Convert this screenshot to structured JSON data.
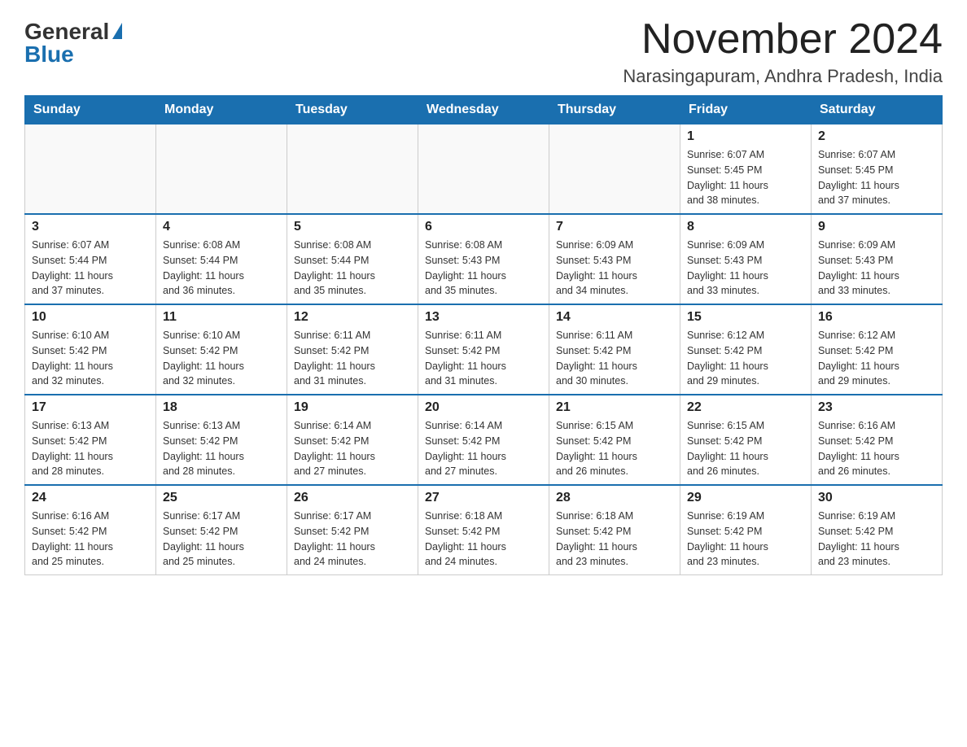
{
  "logo": {
    "general": "General",
    "blue": "Blue"
  },
  "title": {
    "month": "November 2024",
    "location": "Narasingapuram, Andhra Pradesh, India"
  },
  "weekdays": [
    "Sunday",
    "Monday",
    "Tuesday",
    "Wednesday",
    "Thursday",
    "Friday",
    "Saturday"
  ],
  "weeks": [
    [
      {
        "day": "",
        "info": ""
      },
      {
        "day": "",
        "info": ""
      },
      {
        "day": "",
        "info": ""
      },
      {
        "day": "",
        "info": ""
      },
      {
        "day": "",
        "info": ""
      },
      {
        "day": "1",
        "info": "Sunrise: 6:07 AM\nSunset: 5:45 PM\nDaylight: 11 hours\nand 38 minutes."
      },
      {
        "day": "2",
        "info": "Sunrise: 6:07 AM\nSunset: 5:45 PM\nDaylight: 11 hours\nand 37 minutes."
      }
    ],
    [
      {
        "day": "3",
        "info": "Sunrise: 6:07 AM\nSunset: 5:44 PM\nDaylight: 11 hours\nand 37 minutes."
      },
      {
        "day": "4",
        "info": "Sunrise: 6:08 AM\nSunset: 5:44 PM\nDaylight: 11 hours\nand 36 minutes."
      },
      {
        "day": "5",
        "info": "Sunrise: 6:08 AM\nSunset: 5:44 PM\nDaylight: 11 hours\nand 35 minutes."
      },
      {
        "day": "6",
        "info": "Sunrise: 6:08 AM\nSunset: 5:43 PM\nDaylight: 11 hours\nand 35 minutes."
      },
      {
        "day": "7",
        "info": "Sunrise: 6:09 AM\nSunset: 5:43 PM\nDaylight: 11 hours\nand 34 minutes."
      },
      {
        "day": "8",
        "info": "Sunrise: 6:09 AM\nSunset: 5:43 PM\nDaylight: 11 hours\nand 33 minutes."
      },
      {
        "day": "9",
        "info": "Sunrise: 6:09 AM\nSunset: 5:43 PM\nDaylight: 11 hours\nand 33 minutes."
      }
    ],
    [
      {
        "day": "10",
        "info": "Sunrise: 6:10 AM\nSunset: 5:42 PM\nDaylight: 11 hours\nand 32 minutes."
      },
      {
        "day": "11",
        "info": "Sunrise: 6:10 AM\nSunset: 5:42 PM\nDaylight: 11 hours\nand 32 minutes."
      },
      {
        "day": "12",
        "info": "Sunrise: 6:11 AM\nSunset: 5:42 PM\nDaylight: 11 hours\nand 31 minutes."
      },
      {
        "day": "13",
        "info": "Sunrise: 6:11 AM\nSunset: 5:42 PM\nDaylight: 11 hours\nand 31 minutes."
      },
      {
        "day": "14",
        "info": "Sunrise: 6:11 AM\nSunset: 5:42 PM\nDaylight: 11 hours\nand 30 minutes."
      },
      {
        "day": "15",
        "info": "Sunrise: 6:12 AM\nSunset: 5:42 PM\nDaylight: 11 hours\nand 29 minutes."
      },
      {
        "day": "16",
        "info": "Sunrise: 6:12 AM\nSunset: 5:42 PM\nDaylight: 11 hours\nand 29 minutes."
      }
    ],
    [
      {
        "day": "17",
        "info": "Sunrise: 6:13 AM\nSunset: 5:42 PM\nDaylight: 11 hours\nand 28 minutes."
      },
      {
        "day": "18",
        "info": "Sunrise: 6:13 AM\nSunset: 5:42 PM\nDaylight: 11 hours\nand 28 minutes."
      },
      {
        "day": "19",
        "info": "Sunrise: 6:14 AM\nSunset: 5:42 PM\nDaylight: 11 hours\nand 27 minutes."
      },
      {
        "day": "20",
        "info": "Sunrise: 6:14 AM\nSunset: 5:42 PM\nDaylight: 11 hours\nand 27 minutes."
      },
      {
        "day": "21",
        "info": "Sunrise: 6:15 AM\nSunset: 5:42 PM\nDaylight: 11 hours\nand 26 minutes."
      },
      {
        "day": "22",
        "info": "Sunrise: 6:15 AM\nSunset: 5:42 PM\nDaylight: 11 hours\nand 26 minutes."
      },
      {
        "day": "23",
        "info": "Sunrise: 6:16 AM\nSunset: 5:42 PM\nDaylight: 11 hours\nand 26 minutes."
      }
    ],
    [
      {
        "day": "24",
        "info": "Sunrise: 6:16 AM\nSunset: 5:42 PM\nDaylight: 11 hours\nand 25 minutes."
      },
      {
        "day": "25",
        "info": "Sunrise: 6:17 AM\nSunset: 5:42 PM\nDaylight: 11 hours\nand 25 minutes."
      },
      {
        "day": "26",
        "info": "Sunrise: 6:17 AM\nSunset: 5:42 PM\nDaylight: 11 hours\nand 24 minutes."
      },
      {
        "day": "27",
        "info": "Sunrise: 6:18 AM\nSunset: 5:42 PM\nDaylight: 11 hours\nand 24 minutes."
      },
      {
        "day": "28",
        "info": "Sunrise: 6:18 AM\nSunset: 5:42 PM\nDaylight: 11 hours\nand 23 minutes."
      },
      {
        "day": "29",
        "info": "Sunrise: 6:19 AM\nSunset: 5:42 PM\nDaylight: 11 hours\nand 23 minutes."
      },
      {
        "day": "30",
        "info": "Sunrise: 6:19 AM\nSunset: 5:42 PM\nDaylight: 11 hours\nand 23 minutes."
      }
    ]
  ]
}
